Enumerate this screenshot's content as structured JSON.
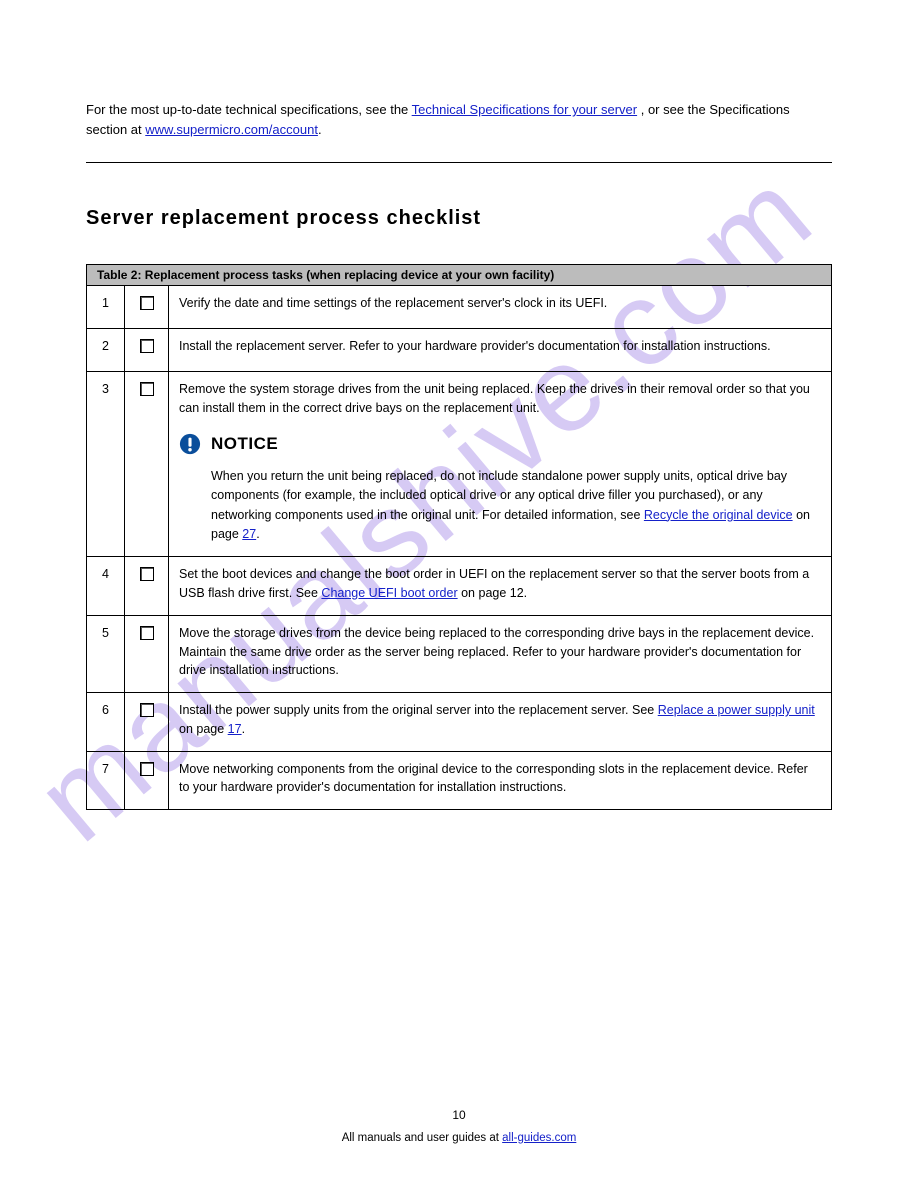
{
  "watermark": "manualshive.com",
  "intro": {
    "p1a": "For the most up-to-date technical specifications, see the ",
    "link1": "Technical Specifications for your server",
    "p1b": ", or see the Specifications section at ",
    "link2": "www.supermicro.com/account",
    "p1c": "."
  },
  "heading": "Server replacement process checklist",
  "table": {
    "header": "Table 2: Replacement process tasks (when replacing device at your own facility)",
    "rows": [
      {
        "num": "1",
        "text": "Verify the date and time settings of the replacement server's clock in its UEFI."
      },
      {
        "num": "2",
        "text": "Install the replacement server. Refer to your hardware provider's documentation for installation instructions."
      },
      {
        "num": "3",
        "p1": "Remove the system storage drives from the unit being replaced. Keep the drives in their removal order so that you can install them in the correct drive bays on the replacement unit.",
        "notice_label": "NOTICE",
        "notice_a": "When you return the unit being replaced, do not include standalone power supply units, optical drive bay components (for example, the included optical drive or any optical drive filler you purchased), or any networking components used in the original unit. For detailed information, see ",
        "link1": "Recycle the original device",
        "notice_b": " on page ",
        "link2": "27",
        "notice_c": "."
      },
      {
        "num": "4",
        "a": "Set the boot devices and change the boot order in UEFI on the replacement server so that the server boots from a USB flash drive first. See ",
        "link": "Change UEFI boot order",
        "b": " on page 12."
      },
      {
        "num": "5",
        "text": "Move the storage drives from the device being replaced to the corresponding drive bays in the replacement device. Maintain the same drive order as the server being replaced. Refer to your hardware provider's documentation for drive installation instructions."
      },
      {
        "num": "6",
        "a": "Install the power supply units from the original server into the replacement server. See ",
        "link": "Replace a power supply unit",
        "b": " on page ",
        "link2": "17",
        "c": "."
      },
      {
        "num": "7",
        "text": "Move networking components from the original device to the corresponding slots in the replacement device. Refer to your hardware provider's documentation for installation instructions."
      }
    ]
  },
  "footer": {
    "page": "10",
    "a": "All manuals and user guides at ",
    "link": "all-guides.com",
    "b": ""
  }
}
